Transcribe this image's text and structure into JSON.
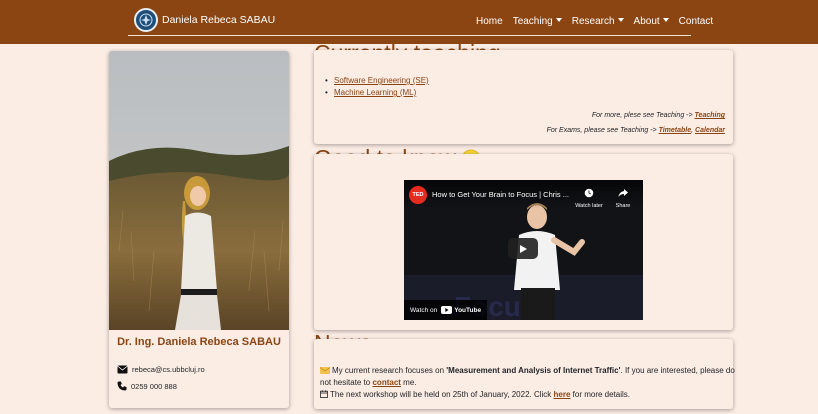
{
  "nav": {
    "brand": "Daniela Rebeca SABAU",
    "items": [
      {
        "label": "Home",
        "dropdown": false
      },
      {
        "label": "Teaching",
        "dropdown": true
      },
      {
        "label": "Research",
        "dropdown": true
      },
      {
        "label": "About",
        "dropdown": true
      },
      {
        "label": "Contact",
        "dropdown": false
      }
    ]
  },
  "profile": {
    "name": "Dr. Ing. Daniela Rebeca SABAU",
    "email": "rebeca@cs.ubbcluj.ro",
    "phone": "0259 000 888"
  },
  "teaching": {
    "title": "Currently teaching",
    "courses": [
      "Software Engineering (SE)",
      "Machine Learning (ML)"
    ],
    "note1_prefix": "For more, plese see Teaching -> ",
    "note1_link": "Teaching",
    "note2_prefix": "For Exams, please see Teaching -> ",
    "note2_link1": "Timetable",
    "note2_sep": ", ",
    "note2_link2": "Calendar"
  },
  "good": {
    "title": "Good to know",
    "video_title": "How to Get Your Brain to Focus | Chris ...",
    "watch_later": "Watch later",
    "share": "Share",
    "watch_on": "Watch on",
    "youtube": "YouTube",
    "ted": "TED"
  },
  "news": {
    "title": "News",
    "line1_prefix": "My current research focuses on ",
    "line1_bold": "'Measurement and Analysis of Internet Traffic'",
    "line1_suffix": ". If you are interested, please do",
    "line2_prefix": "not hesitate to ",
    "line2_link": "contact",
    "line2_suffix": " me.",
    "line3_prefix": "The next workshop will be held on 25th of January, 2022. Click ",
    "line3_link": "here",
    "line3_suffix": " for more details."
  },
  "colors": {
    "brand": "#8b4513",
    "background": "#fbece4"
  }
}
